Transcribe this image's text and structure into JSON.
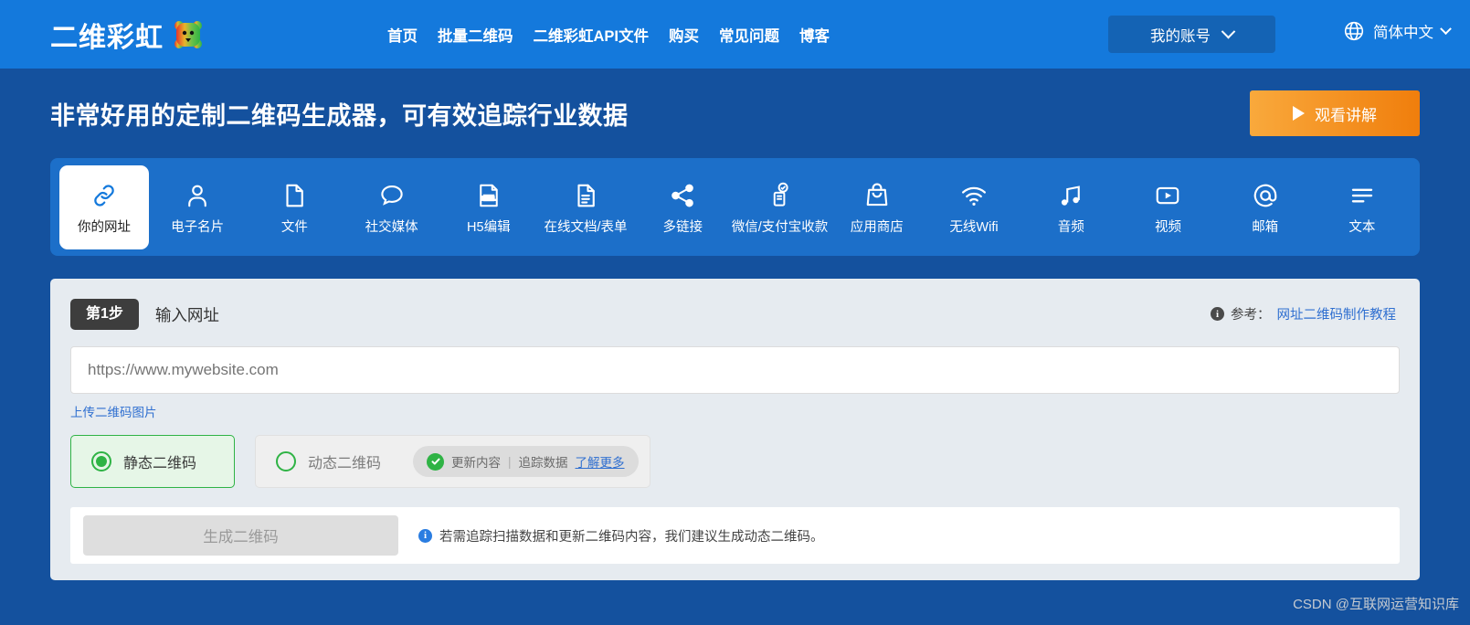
{
  "brand": {
    "name": "二维彩虹",
    "mascot_icon": "rainbow-bear-icon"
  },
  "nav": {
    "items": [
      {
        "label": "首页"
      },
      {
        "label": "批量二维码"
      },
      {
        "label": "二维彩虹API文件"
      },
      {
        "label": "购买"
      },
      {
        "label": "常见问题"
      },
      {
        "label": "博客"
      }
    ],
    "account_label": "我的账号",
    "language_label": "简体中文"
  },
  "hero": {
    "title": "非常好用的定制二维码生成器，可有效追踪行业数据",
    "watch_button": "观看讲解"
  },
  "tabs": [
    {
      "label": "你的网址",
      "icon": "link-icon",
      "active": true
    },
    {
      "label": "电子名片",
      "icon": "person-icon",
      "active": false
    },
    {
      "label": "文件",
      "icon": "file-icon",
      "active": false
    },
    {
      "label": "社交媒体",
      "icon": "chat-bubble-icon",
      "active": false
    },
    {
      "label": "H5编辑",
      "icon": "html-icon",
      "active": false
    },
    {
      "label": "在线文档/表单",
      "icon": "document-icon",
      "active": false
    },
    {
      "label": "多链接",
      "icon": "share-icon",
      "active": false
    },
    {
      "label": "微信/支付宝收款",
      "icon": "payment-icon",
      "active": false
    },
    {
      "label": "应用商店",
      "icon": "shopping-bag-icon",
      "active": false
    },
    {
      "label": "无线Wifi",
      "icon": "wifi-icon",
      "active": false
    },
    {
      "label": "音频",
      "icon": "music-note-icon",
      "active": false
    },
    {
      "label": "视频",
      "icon": "video-play-icon",
      "active": false
    },
    {
      "label": "邮箱",
      "icon": "at-sign-icon",
      "active": false
    },
    {
      "label": "文本",
      "icon": "text-lines-icon",
      "active": false
    }
  ],
  "step": {
    "badge": "第1步",
    "title": "输入网址",
    "reference_label": "参考：",
    "reference_link": "网址二维码制作教程"
  },
  "form": {
    "url_value": "",
    "url_placeholder": "https://www.mywebsite.com",
    "upload_link": "上传二维码图片",
    "static_label": "静态二维码",
    "dynamic_label": "动态二维码",
    "pill_update": "更新内容",
    "pill_sep": "|",
    "pill_track": "追踪数据",
    "pill_more": "了解更多",
    "generate_button": "生成二维码",
    "hint": "若需追踪扫描数据和更新二维码内容，我们建议生成动态二维码。"
  },
  "watermark": "CSDN @互联网运营知识库",
  "colors": {
    "header_blue": "#1479DC",
    "hero_blue": "#14519E",
    "tabstrip_blue": "#1C6FC9",
    "accent_orange": "#F4900F",
    "green": "#2FB345",
    "link_blue": "#2F6FD0",
    "card_bg": "#E6EBF0"
  }
}
